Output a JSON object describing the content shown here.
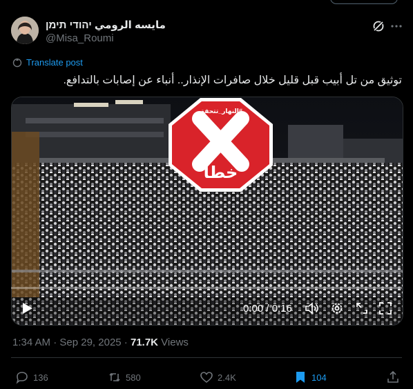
{
  "author": {
    "name": "مايسه الرومي יהודי תימן",
    "handle": "@Misa_Roumi"
  },
  "translate_label": "Translate post",
  "tweet_text": "توثيق من تل أبيب قبل قليل خلال صافرات الإنذار.. أنباء عن إصابات بالتدافع.",
  "stamp": {
    "top_text": "#النهار_تتحقق",
    "bottom_text": "خطأ"
  },
  "video": {
    "time": "0:00 / 0:16",
    "progress": 0
  },
  "meta": {
    "time": "1:34 AM",
    "separator1": " · ",
    "date": "Sep 29, 2025",
    "separator2": " · ",
    "views_count": "71.7K",
    "views_label": " Views"
  },
  "actions": {
    "replies": "136",
    "reposts": "580",
    "likes": "2.4K",
    "bookmarks": "104"
  },
  "colors": {
    "accent": "#1d9bf0",
    "stamp_red": "#d9232a"
  }
}
